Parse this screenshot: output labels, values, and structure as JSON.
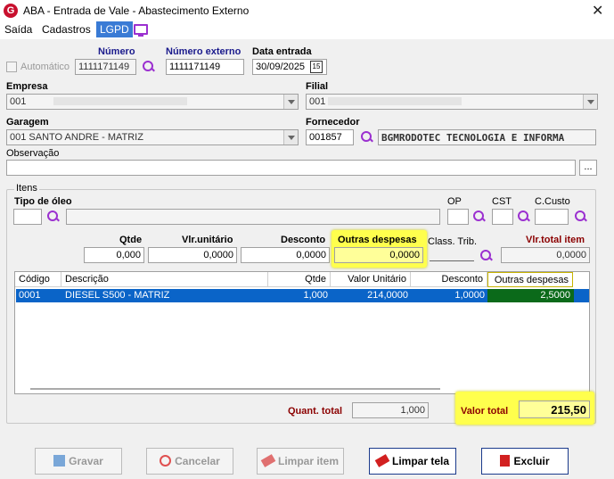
{
  "window": {
    "title": "ABA - Entrada de Vale - Abastecimento Externo",
    "app_icon": "G",
    "close": "✕"
  },
  "menu": {
    "items": [
      "Saída",
      "Cadastros",
      "LGPD"
    ]
  },
  "header": {
    "automatico_label": "Automático",
    "numero_label": "Número",
    "numero_value": "1111171149",
    "numero_externo_label": "Número externo",
    "numero_externo_value": "1111171149",
    "data_entrada_label": "Data entrada",
    "data_entrada_value": "30/09/2025",
    "calendar_glyph": "15"
  },
  "empresa": {
    "label": "Empresa",
    "value": "001"
  },
  "filial": {
    "label": "Filial",
    "value": "001"
  },
  "garagem": {
    "label": "Garagem",
    "value": "001 SANTO ANDRE - MATRIZ"
  },
  "fornecedor": {
    "label": "Fornecedor",
    "code": "001857",
    "name": "BGMRODOTEC TECNOLOGIA E INFORMA"
  },
  "observacao": {
    "label": "Observação",
    "browse": "..."
  },
  "itens": {
    "group_label": "Itens",
    "tipo_oleo_label": "Tipo de óleo",
    "op_label": "OP",
    "cst_label": "CST",
    "ccusto_label": "C.Custo",
    "qtde_label": "Qtde",
    "qtde_value": "0,000",
    "vlr_unit_label": "Vlr.unitário",
    "vlr_unit_value": "0,0000",
    "desconto_label": "Desconto",
    "desconto_value": "0,0000",
    "outras_label": "Outras despesas",
    "outras_value": "0,0000",
    "class_trib_label": "Class. Trib.",
    "vlr_total_item_label": "Vlr.total item",
    "vlr_total_item_value": "0,0000"
  },
  "grid": {
    "columns": [
      "Código",
      "Descrição",
      "Qtde",
      "Valor Unitário",
      "Desconto",
      "Outras despesas"
    ],
    "rows": [
      {
        "codigo": "0001",
        "descricao": "DIESEL S500 - MATRIZ",
        "qtde": "1,000",
        "valor_unitario": "214,0000",
        "desconto": "1,0000",
        "outras": "2,5000"
      }
    ]
  },
  "totals": {
    "quant_label": "Quant. total",
    "quant_value": "1,000",
    "valor_label": "Valor total",
    "valor_value": "215,50"
  },
  "buttons": {
    "gravar": "Gravar",
    "cancelar": "Cancelar",
    "limpar_item": "Limpar item",
    "limpar_tela": "Limpar tela",
    "excluir": "Excluir"
  },
  "colors": {
    "highlight": "#ffff4d",
    "selection": "#0a64c8",
    "accent": "#9b30d0",
    "brand": "#c8102e"
  }
}
